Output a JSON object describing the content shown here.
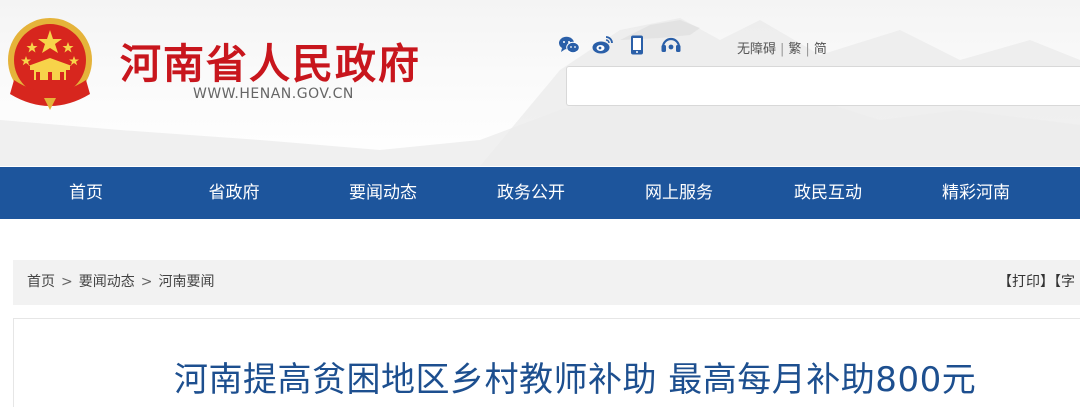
{
  "header": {
    "site_title": "河南省人民政府",
    "site_url": "WWW.HENAN.GOV.CN",
    "icons": [
      "wechat-icon",
      "weibo-icon",
      "mobile-icon",
      "headset-icon"
    ],
    "links": {
      "accessible": "无障碍",
      "traditional": "繁",
      "simplified": "简"
    },
    "search_placeholder": ""
  },
  "nav": {
    "items": [
      "首页",
      "省政府",
      "要闻动态",
      "政务公开",
      "网上服务",
      "政民互动",
      "精彩河南"
    ]
  },
  "breadcrumb": {
    "items": [
      "首页",
      "要闻动态",
      "河南要闻"
    ],
    "separator": ">"
  },
  "tools": {
    "print": "【打印】",
    "font": "【字"
  },
  "article": {
    "title": "河南提高贫困地区乡村教师补助 最高每月补助800元"
  },
  "colors": {
    "brand_red": "#c8161d",
    "nav_blue": "#1d559c",
    "title_blue": "#1d4f8f",
    "icon_blue": "#2a5fa8"
  }
}
